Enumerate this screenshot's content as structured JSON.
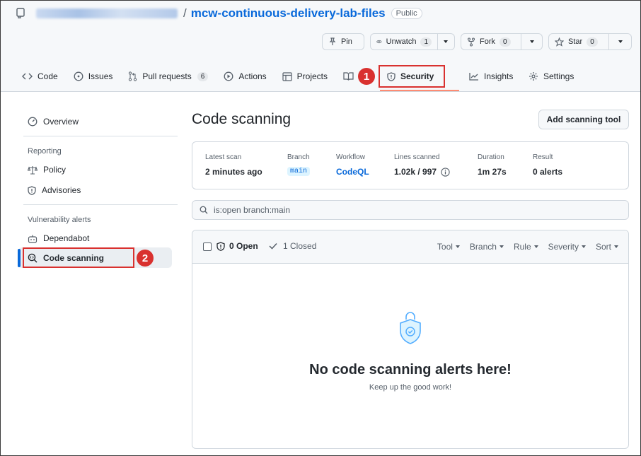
{
  "repo": {
    "owner_blurred": "",
    "separator": "/",
    "name": "mcw-continuous-delivery-lab-files",
    "visibility": "Public"
  },
  "repo_actions": {
    "pin": "Pin",
    "unwatch": "Unwatch",
    "unwatch_count": "1",
    "fork": "Fork",
    "fork_count": "0",
    "star": "Star",
    "star_count": "0"
  },
  "tabs": {
    "code": "Code",
    "issues": "Issues",
    "pull_requests": "Pull requests",
    "pull_requests_count": "6",
    "actions": "Actions",
    "projects": "Projects",
    "wiki": "W",
    "security": "Security",
    "insights": "Insights",
    "settings": "Settings"
  },
  "steps": {
    "one": "1",
    "two": "2"
  },
  "sidebar": {
    "overview": "Overview",
    "reporting_heading": "Reporting",
    "policy": "Policy",
    "advisories": "Advisories",
    "vuln_heading": "Vulnerability alerts",
    "dependabot": "Dependabot",
    "code_scanning": "Code scanning"
  },
  "main": {
    "title": "Code scanning",
    "add_tool": "Add scanning tool",
    "stats": {
      "latest_scan_label": "Latest scan",
      "latest_scan_value": "2 minutes ago",
      "branch_label": "Branch",
      "branch_value": "main",
      "workflow_label": "Workflow",
      "workflow_value": "CodeQL",
      "lines_label": "Lines scanned",
      "lines_value": "1.02k / 997",
      "duration_label": "Duration",
      "duration_value": "1m 27s",
      "result_label": "Result",
      "result_value": "0 alerts"
    },
    "search_value": "is:open branch:main",
    "results": {
      "open": "0 Open",
      "closed": "1 Closed",
      "filters": [
        "Tool",
        "Branch",
        "Rule",
        "Severity",
        "Sort"
      ],
      "empty_title": "No code scanning alerts here!",
      "empty_sub": "Keep up the good work!"
    }
  },
  "colors": {
    "accent": "#0969da",
    "annotation_red": "#d9312f",
    "tab_underline": "#fd8c73"
  }
}
